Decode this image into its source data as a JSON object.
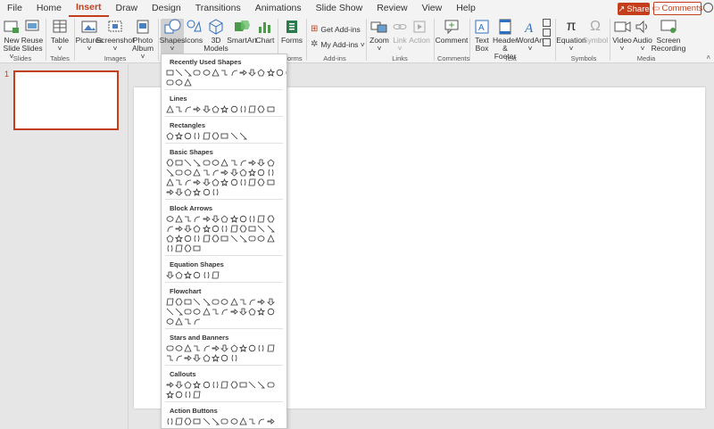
{
  "tabs": [
    "File",
    "Home",
    "Insert",
    "Draw",
    "Design",
    "Transitions",
    "Animations",
    "Slide Show",
    "Review",
    "View",
    "Help"
  ],
  "active_tab": "Insert",
  "share_label": "Share",
  "comments_label": "Comments",
  "ribbon": {
    "new_slide": [
      "New",
      "Slide ˅"
    ],
    "reuse_slides": [
      "Reuse",
      "Slides"
    ],
    "table": [
      "Table",
      "˅"
    ],
    "pictures": [
      "Pictures",
      "˅"
    ],
    "screenshot": [
      "Screenshot",
      "˅"
    ],
    "photo_album": [
      "Photo",
      "Album ˅"
    ],
    "shapes": [
      "Shapes",
      "˅"
    ],
    "icons": [
      "Icons",
      ""
    ],
    "models3d": [
      "3D",
      "Models ˅"
    ],
    "smartart": [
      "SmartArt",
      ""
    ],
    "chart": [
      "Chart",
      ""
    ],
    "forms": [
      "Forms",
      ""
    ],
    "get_addins": "Get Add-ins",
    "my_addins": "My Add-ins  ˅",
    "zoom": [
      "Zoom",
      "˅"
    ],
    "link": [
      "Link",
      "˅"
    ],
    "action": [
      "Action",
      ""
    ],
    "comment": [
      "Comment",
      ""
    ],
    "text_box": [
      "Text",
      "Box"
    ],
    "header_footer": [
      "Header",
      "& Footer"
    ],
    "wordart": [
      "WordArt",
      "˅"
    ],
    "equation": [
      "Equation",
      "˅"
    ],
    "symbol": [
      "Symbol",
      ""
    ],
    "video": [
      "Video",
      "˅"
    ],
    "audio": [
      "Audio",
      "˅"
    ],
    "screen_recording": [
      "Screen",
      "Recording"
    ],
    "groups": {
      "slides": "Slides",
      "tables": "Tables",
      "images": "Images",
      "forms_partial": "orms",
      "addins": "Add-ins",
      "links": "Links",
      "comments": "Comments",
      "text": "Text",
      "symbols": "Symbols",
      "media": "Media"
    }
  },
  "thumbnail": {
    "number": "1"
  },
  "shapes_menu": {
    "sections": [
      {
        "title": "Recently Used Shapes",
        "rows": [
          14,
          3
        ]
      },
      {
        "title": "Lines",
        "rows": [
          12
        ]
      },
      {
        "title": "Rectangles",
        "rows": [
          9
        ]
      },
      {
        "title": "Basic Shapes",
        "rows": [
          12,
          12,
          12,
          6
        ]
      },
      {
        "title": "Block Arrows",
        "rows": [
          12,
          12,
          12,
          4
        ]
      },
      {
        "title": "Equation Shapes",
        "rows": [
          6
        ]
      },
      {
        "title": "Flowchart",
        "rows": [
          12,
          12,
          4
        ]
      },
      {
        "title": "Stars and Banners",
        "rows": [
          12,
          8
        ]
      },
      {
        "title": "Callouts",
        "rows": [
          12,
          4
        ]
      },
      {
        "title": "Action Buttons",
        "rows": [
          12
        ]
      }
    ]
  },
  "colors": {
    "accent": "#c43e1c",
    "ribbon_bg": "#f3f3f3",
    "canvas_bg": "#e6e6e6"
  }
}
